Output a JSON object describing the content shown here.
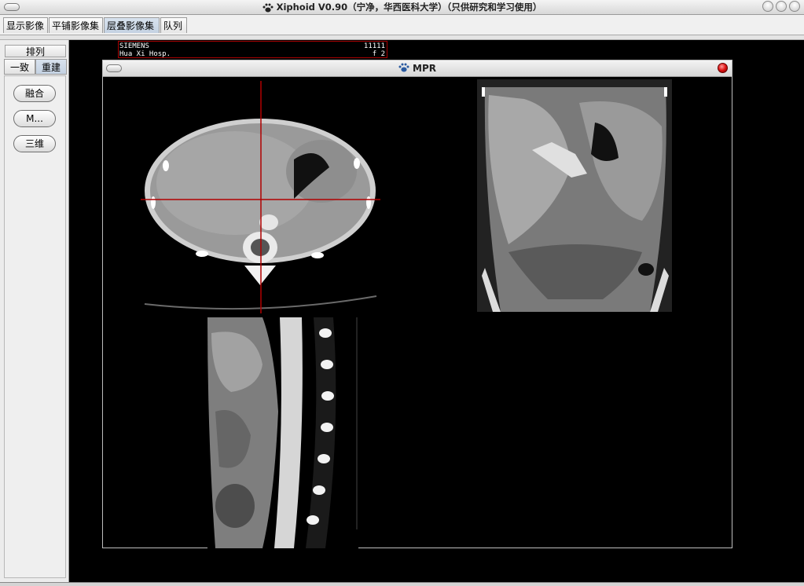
{
  "window": {
    "title": "Xiphoid V0.90（宁净，华西医科大学）（只供研究和学习使用）"
  },
  "tabs": [
    {
      "label": "显示影像",
      "active": false
    },
    {
      "label": "平铺影像集",
      "active": false
    },
    {
      "label": "层叠影像集",
      "active": true
    },
    {
      "label": "队列",
      "active": false
    }
  ],
  "sidebar": {
    "title": "排列",
    "tabs": [
      {
        "label": "一致",
        "active": false
      },
      {
        "label": "重建",
        "active": true
      }
    ],
    "buttons": [
      "融合",
      "M...",
      "三维"
    ]
  },
  "overlay": {
    "line1_left": "SIEMENS",
    "line1_right": "11111",
    "line2_left": "Hua Xi Hosp.",
    "line2_right": "f 2"
  },
  "mpr": {
    "title": "MPR",
    "views": [
      "axial",
      "coronal",
      "sagittal"
    ],
    "crosshair_color": "#b00000"
  },
  "colors": {
    "chrome": "#ececec",
    "active_tab": "#c8d6e6",
    "close_button": "#dd2222"
  }
}
